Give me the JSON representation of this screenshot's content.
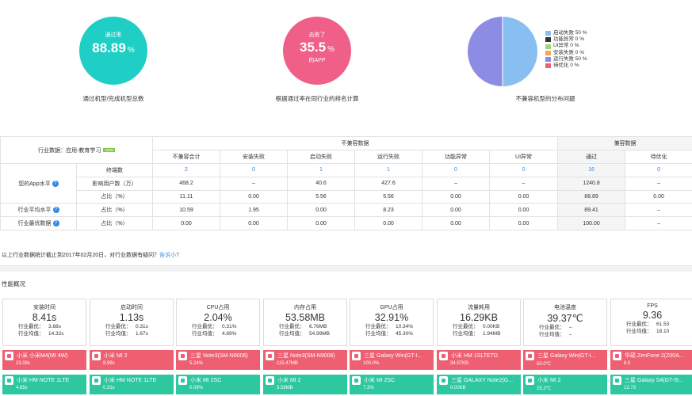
{
  "summary": {
    "pass": {
      "label": "通过率",
      "value": "88.89",
      "unit": "%",
      "caption": "通过机型/完成机型总数",
      "color": "#1fcfc6"
    },
    "beat": {
      "label": "击败了",
      "value": "35.5",
      "unit": "%",
      "sub": "的APP",
      "caption": "根据通过率在同行业的排名计算",
      "color": "#ef5f88"
    },
    "pie": {
      "caption": "不兼容机型的分布问题",
      "legend": [
        {
          "label": "启动失败 50 %",
          "color": "#88bff0",
          "value": 50
        },
        {
          "label": "功能异常 0 %",
          "color": "#333333",
          "value": 0
        },
        {
          "label": "UI异常 0 %",
          "color": "#9fd47a",
          "value": 0
        },
        {
          "label": "安装失败 0 %",
          "color": "#f5a45a",
          "value": 0
        },
        {
          "label": "运行失败 50 %",
          "color": "#8d8ce4",
          "value": 50
        },
        {
          "label": "待优化 0 %",
          "color": "#ee5f76",
          "value": 0
        }
      ]
    }
  },
  "table": {
    "industry_label": "行业数据：应用-教育学习",
    "new_tag": "NEW",
    "group_incompat": "不兼容数据",
    "group_compat": "兼容数据",
    "cols": [
      "不兼容合计",
      "安装失败",
      "启动失败",
      "运行失败",
      "功能异常",
      "UI异常",
      "通过",
      "待优化"
    ],
    "my_app": "您的App水平",
    "industry_avg": "行业平均水平",
    "industry_best": "行业最优数据",
    "rows": [
      {
        "label": "终端数",
        "cells": [
          "2",
          "0",
          "1",
          "1",
          "0",
          "0",
          "16",
          "0"
        ]
      },
      {
        "label": "影响用户数（万）",
        "cells": [
          "468.2",
          "–",
          "40.6",
          "427.6",
          "–",
          "–",
          "1240.8",
          "–"
        ]
      },
      {
        "label": "占比（%）",
        "cells": [
          "11.11",
          "0.00",
          "5.56",
          "5.56",
          "0.00",
          "0.00",
          "88.89",
          "0.00"
        ]
      },
      {
        "label": "占比（%）",
        "cells": [
          "10.59",
          "1.95",
          "0.00",
          "8.23",
          "0.00",
          "0.00",
          "89.41",
          "–"
        ]
      },
      {
        "label": "占比（%）",
        "cells": [
          "0.00",
          "0.00",
          "0.00",
          "0.00",
          "0.00",
          "0.00",
          "100.00",
          "–"
        ]
      }
    ]
  },
  "note": {
    "text": "以上行业数据统计截止到2017年02月20日，对行业数据有疑问？",
    "link": "告诉小T"
  },
  "perf_title": "性能概况",
  "cards": [
    {
      "name": "安装时间",
      "value": "8.41s",
      "best_k": "行业最优：",
      "best": "3.68s",
      "avg_k": "行业均值：",
      "avg": "14.32s"
    },
    {
      "name": "启动时间",
      "value": "1.13s",
      "best_k": "行业最优：",
      "best": "0.31s",
      "avg_k": "行业均值：",
      "avg": "1.67s"
    },
    {
      "name": "CPU占用",
      "value": "2.04%",
      "best_k": "行业最优：",
      "best": "0.31%",
      "avg_k": "行业均值：",
      "avg": "4.89%"
    },
    {
      "name": "内存占用",
      "value": "53.58MB",
      "best_k": "行业最优：",
      "best": "6.76MB",
      "avg_k": "行业均值：",
      "avg": "54.99MB"
    },
    {
      "name": "GPU占用",
      "value": "32.91%",
      "best_k": "行业最优：",
      "best": "10.34%",
      "avg_k": "行业均值：",
      "avg": "45.30%"
    },
    {
      "name": "流量耗用",
      "value": "16.29KB",
      "best_k": "行业最优：",
      "best": "0.00KB",
      "avg_k": "行业均值：",
      "avg": "1.94MB"
    },
    {
      "name": "电池温度",
      "value": "39.37℃",
      "best_k": "行业最优：",
      "best": "–",
      "avg_k": "行业均值：",
      "avg": "–"
    },
    {
      "name": "FPS",
      "value": "9.36",
      "best_k": "行业最优：",
      "best": "61.53",
      "avg_k": "行业均值：",
      "avg": "18.10"
    }
  ],
  "worst": [
    {
      "name": "小米 小米M4(MI 4W)",
      "value": "23.08s"
    },
    {
      "name": "小米 MI 2",
      "value": "8.99s"
    },
    {
      "name": "三星 Note3(SM-N9006)",
      "value": "5.24%"
    },
    {
      "name": "三星 Note3(SM-N9006)",
      "value": "115.47MB"
    },
    {
      "name": "三星 Galaxy Win(GT-I...",
      "value": "100.0%"
    },
    {
      "name": "小米 HM 1SLTETD",
      "value": "34.07KB"
    },
    {
      "name": "三星 Galaxy Win(GT-I...",
      "value": "50.0℃"
    },
    {
      "name": "华硕 ZenFone 2(Z00A...",
      "value": "6.0"
    }
  ],
  "best": [
    {
      "name": "小米 HM NOTE 1LTE",
      "value": "4.85s"
    },
    {
      "name": "小米 HM NOTE 1LTE",
      "value": "0.31s"
    },
    {
      "name": "小米 MI 2SC",
      "value": "0.09%"
    },
    {
      "name": "小米 MI 2",
      "value": "3.58MB"
    },
    {
      "name": "小米 MI 2SC",
      "value": "7.3%"
    },
    {
      "name": "三星 GALAXY Note2(G...",
      "value": "0.00KB"
    },
    {
      "name": "小米 MI 2",
      "value": "25.2℃"
    },
    {
      "name": "三星 Galaxy S4(GT-I9...",
      "value": "12.73"
    }
  ]
}
